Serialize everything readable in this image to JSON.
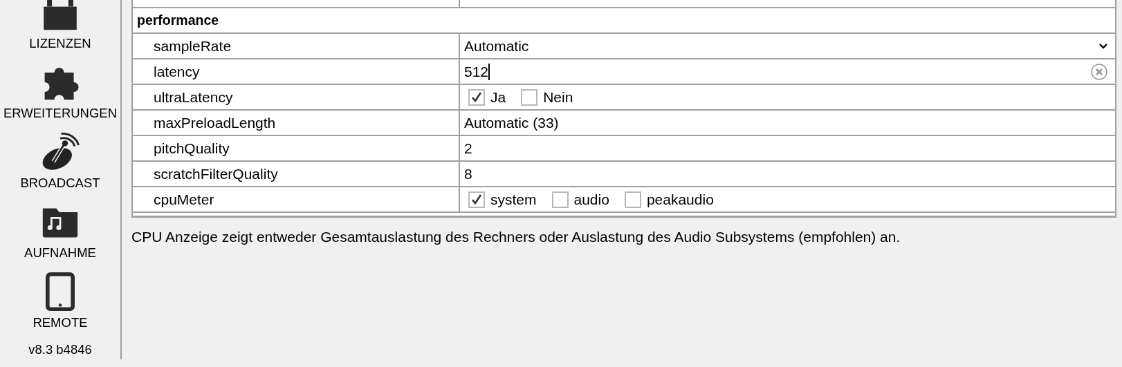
{
  "sidebar": {
    "items": [
      {
        "label": "LIZENZEN",
        "kind": "lock"
      },
      {
        "label": "ERWEITERUNGEN",
        "kind": "puzzle"
      },
      {
        "label": "BROADCAST",
        "kind": "dish"
      },
      {
        "label": "AUFNAHME",
        "kind": "folder"
      },
      {
        "label": "REMOTE",
        "kind": "tablet"
      }
    ],
    "version": "v8.3 b4846"
  },
  "table": {
    "section": "performance",
    "rows": [
      {
        "name": "sampleRate",
        "kind": "select",
        "value": "Automatic"
      },
      {
        "name": "latency",
        "kind": "input",
        "value": "512"
      },
      {
        "name": "ultraLatency",
        "kind": "checks",
        "options": [
          {
            "label": "Ja",
            "checked": true
          },
          {
            "label": "Nein",
            "checked": false
          }
        ]
      },
      {
        "name": "maxPreloadLength",
        "kind": "text",
        "value": "Automatic (33)"
      },
      {
        "name": "pitchQuality",
        "kind": "text",
        "value": "2"
      },
      {
        "name": "scratchFilterQuality",
        "kind": "text",
        "value": "8"
      },
      {
        "name": "cpuMeter",
        "kind": "checks",
        "options": [
          {
            "label": "system",
            "checked": true
          },
          {
            "label": "audio",
            "checked": false
          },
          {
            "label": "peakaudio",
            "checked": false
          }
        ]
      }
    ]
  },
  "description": "CPU Anzeige zeigt entweder Gesamtauslastung des Rechners oder Auslastung des Audio Subsystems (empfohlen) an."
}
